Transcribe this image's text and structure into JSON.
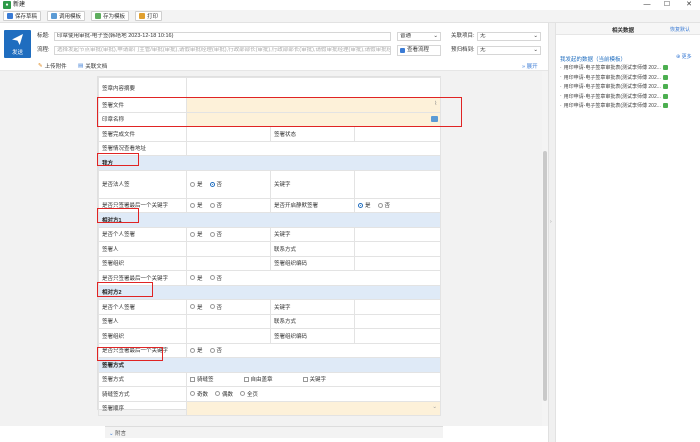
{
  "window": {
    "title": "新建",
    "min": "—",
    "max": "☐",
    "close": "✕"
  },
  "toolbar": {
    "save_draft": "保存草稿",
    "use_template": "调用模板",
    "save_template": "存为模板",
    "print": "打印"
  },
  "header": {
    "send_label": "发送",
    "title_label": "标题:",
    "title_value": "印章使用审批-电子签(韩塔地 2023-12-18 10:16)",
    "title_dropdown": "普通",
    "flow_label": "流程:",
    "flow_value": "选择发起节点审批(审批),申请部门主管/审批(审批),请假审批经理(审批),行政部部长(审批),行政部部长(审批),请假审批经理(审批),请假审批经理(审批),请假审批经理(审批)...",
    "view_flow": "查看流程",
    "related_project_label": "关联项目:",
    "related_project_value": "无",
    "archive_label": "预归档到:",
    "archive_value": "无"
  },
  "attach": {
    "upload": "上传附件",
    "related_doc": "关联文档",
    "expand": "展开"
  },
  "form": {
    "row_content_summary": "签章内容摘要",
    "row_sign_file": "签署文件",
    "row_seal_name": "印章名称",
    "row_signed_file": "签署完成文件",
    "row_sign_status": "签署状态",
    "row_sign_view_addr": "签署情况查看地址",
    "sec_our": "我方",
    "row_is_legal": "是否法人签",
    "yes": "是",
    "no": "否",
    "row_keyword": "关键字",
    "row_last_keyword": "是否只签署最后一个关键字",
    "row_auto_silent": "是否开启静默签署",
    "sec_party1": "相对方1",
    "row_is_personal": "是否个人签署",
    "row_signer": "签署人",
    "row_contact": "联系方式",
    "row_sign_org": "签署组织",
    "row_sign_org_code": "签署组织编码",
    "sec_party2": "相对方2",
    "sec_method": "签署方式",
    "row_method": "签署方式",
    "opt_seam": "骑缝签",
    "opt_free": "自由盖章",
    "opt_keyword": "关键字",
    "row_seam_method": "骑缝签方式",
    "opt_odd": "奇数",
    "opt_even": "偶数",
    "opt_all": "全页",
    "row_sign_order": "签署顺序"
  },
  "bottom": {
    "attachment": "附言"
  },
  "rightpanel": {
    "tab_related": "相关数据",
    "tab_reset": "恢复默认",
    "section_title": "我发起的数据（当前模板）",
    "more": "更多",
    "items": [
      "用印申请-电子签章审批表(测试李师傅 202...",
      "用印申请-电子签章审批表(测试李师傅 202...",
      "用印申请-电子签章审批表(测试李师傅 202...",
      "用印申请-电子签章审批表(测试李师傅 202...",
      "用印申请-电子签章审批表(测试李师傅 202..."
    ]
  },
  "colors": {
    "accent": "#1f6dbf",
    "section_bg": "#dfeaf7",
    "required_bg": "#fdf1d9",
    "highlight": "#e02424"
  }
}
